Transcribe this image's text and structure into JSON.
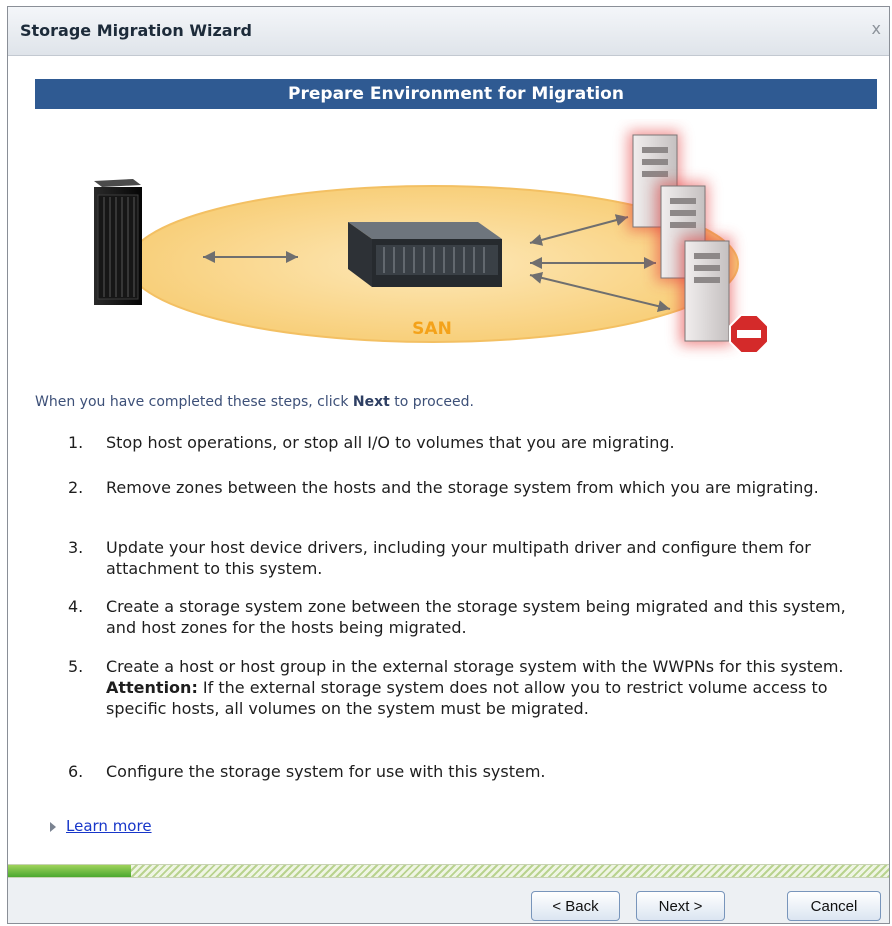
{
  "window": {
    "title": "Storage Migration Wizard",
    "close_glyph": "x"
  },
  "banner": {
    "title": "Prepare Environment for Migration"
  },
  "illustration": {
    "san_label": "SAN"
  },
  "intro": {
    "before": "When you have completed these steps, click ",
    "emphasis": "Next",
    "after": " to proceed."
  },
  "steps": [
    {
      "num": "1.",
      "text": "Stop host operations, or stop all I/O to volumes that you are migrating."
    },
    {
      "num": "2.",
      "text": "Remove zones between the hosts and the storage system from which you are migrating."
    },
    {
      "num": "3.",
      "text": "Update your host device drivers, including your multipath driver and configure them for attachment to this system."
    },
    {
      "num": "4.",
      "text": "Create a storage system zone between the storage system being migrated and this system, and host zones for the hosts being migrated."
    },
    {
      "num": "5.",
      "text_before": "Create a host or host group in the external storage system with the WWPNs for this system. ",
      "attention": "Attention:",
      "text_after": " If the external storage system does not allow you to restrict volume access to specific hosts, all volumes on the system must be migrated."
    },
    {
      "num": "6.",
      "text": "Configure the storage system for use with this system."
    }
  ],
  "learn_more": {
    "label": "Learn more"
  },
  "progress": {
    "fraction": 0.14
  },
  "buttons": {
    "back": "< Back",
    "next": "Next >",
    "cancel": "Cancel"
  },
  "colors": {
    "banner": "#2f5a92",
    "link": "#1736c9",
    "progress_fill": "#4aa82f",
    "alert": "#d42a2a"
  }
}
